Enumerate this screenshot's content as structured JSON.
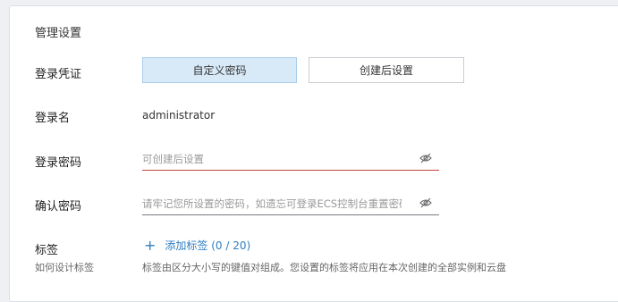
{
  "section": {
    "title": "管理设置"
  },
  "credential": {
    "label": "登录凭证",
    "options": [
      "自定义密码",
      "创建后设置"
    ],
    "selected": "自定义密码"
  },
  "login_name": {
    "label": "登录名",
    "value": "administrator"
  },
  "password": {
    "label": "登录密码",
    "placeholder": "可创建后设置",
    "value": "",
    "icon": "eye-off-icon"
  },
  "confirm_password": {
    "label": "确认密码",
    "placeholder": "请牢记您所设置的密码，如遗忘可登录ECS控制台重置密码",
    "value": "",
    "icon": "eye-off-icon"
  },
  "tags": {
    "label": "标签",
    "help_link": "如何设计标签",
    "add_label": "添加标签",
    "count": "(0 / 20)",
    "description": "标签由区分大小写的键值对组成。您设置的标签将应用在本次创建的全部实例和云盘"
  },
  "colors": {
    "accent": "#2d7ec4",
    "selected_bg": "#d8eaf8",
    "error_underline": "#c0413b"
  }
}
